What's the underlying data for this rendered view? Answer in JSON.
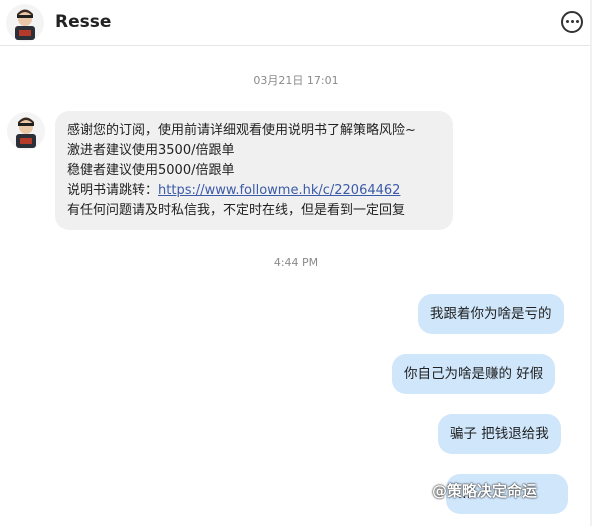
{
  "header": {
    "contact_name": "Resse",
    "more_icon": "more-horizontal-circle-icon"
  },
  "timestamps": {
    "first": "03月21日 17:01",
    "second": "4:44 PM"
  },
  "incoming_message": {
    "line1": "感谢您的订阅，使用前请详细观看使用说明书了解策略风险~",
    "line2": "激进者建议使用3500/倍跟单",
    "line3": "稳健者建议使用5000/倍跟单",
    "line4_prefix": "说明书请跳转：",
    "line4_link": "https://www.followme.hk/c/22064462",
    "line5": "有任何问题请及时私信我，不定时在线，但是看到一定回复"
  },
  "outgoing_messages": [
    "我跟着你为啥是亏的",
    "你自己为啥是赚的   好假",
    "骗子  把钱退给我",
    "..."
  ],
  "watermark": "@策略决定命运",
  "colors": {
    "incoming_bubble": "#f0f0f0",
    "outgoing_bubble": "#cfe6fb",
    "link": "#3b5aa8"
  }
}
